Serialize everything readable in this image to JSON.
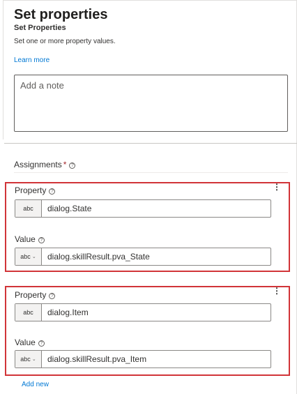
{
  "panel": {
    "title": "Set properties",
    "subtitle": "Set Properties",
    "description": "Set one or more property values.",
    "learn_more": "Learn more",
    "note_placeholder": "Add a note"
  },
  "assignments": {
    "label": "Assignments",
    "required_mark": "*",
    "info_icon": "?",
    "more_icon": "⋮",
    "items": [
      {
        "property_label": "Property",
        "property_type": "abc",
        "property_value": "dialog.State",
        "value_label": "Value",
        "value_type": "abc",
        "value_value": "dialog.skillResult.pva_State"
      },
      {
        "property_label": "Property",
        "property_type": "abc",
        "property_value": "dialog.Item",
        "value_label": "Value",
        "value_type": "abc",
        "value_value": "dialog.skillResult.pva_Item"
      }
    ],
    "add_new": "Add new"
  },
  "colors": {
    "accent": "#0078d4",
    "highlight": "#d13438",
    "required": "#a4262c"
  }
}
